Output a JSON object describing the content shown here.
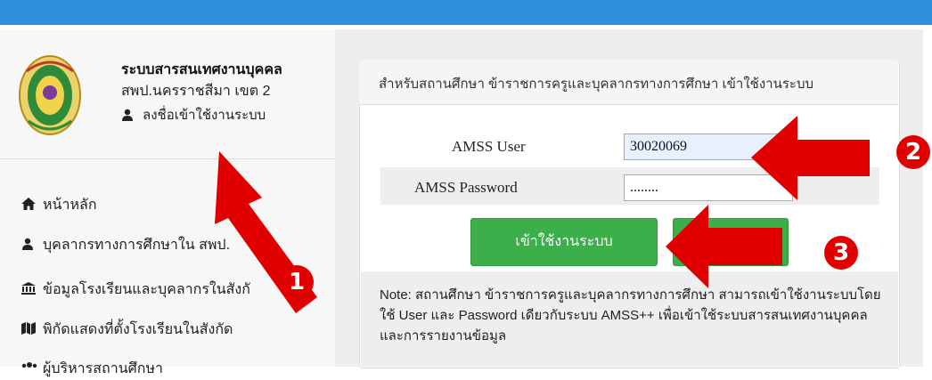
{
  "header": {
    "site_title": "ระบบสารสนเทศงานบุคคล",
    "site_subtitle": "สพป.นครราชสีมา เขต 2",
    "login_link": "ลงชื่อเข้าใช้งานระบบ"
  },
  "sidebar": {
    "items": [
      {
        "icon": "home-icon",
        "label": "หน้าหลัก"
      },
      {
        "icon": "user-icon",
        "label": "บุคลากรทางการศึกษาใน สพป."
      },
      {
        "icon": "bank-icon",
        "label": "ข้อมูลโรงเรียนและบุคลากรในสังกั"
      },
      {
        "icon": "map-icon",
        "label": "พิกัดแสดงที่ตั้งโรงเรียนในสังกัด"
      },
      {
        "icon": "users-icon",
        "label": "ผู้บริหารสถานศึกษา"
      }
    ]
  },
  "login_form": {
    "header": "สำหรับสถานศึกษา ข้าราชการครูและบุคลากรทางการศึกษา เข้าใช้งานระบบ",
    "user_label": "AMSS User",
    "user_value": "30020069",
    "password_label": "AMSS Password",
    "password_value": "........",
    "login_button": "เข้าใช้งานระบบ",
    "note": "Note: สถานศึกษา ข้าราชการครูและบุคลากรทางการศึกษา สามารถเข้าใช้งานระบบโดยใช้ User และ Password เดียวกับระบบ AMSS++ เพื่อเข้าใช้ระบบสารสนเทศงานบุคคล และการรายงานข้อมูล"
  },
  "annotations": {
    "step1": "1",
    "step2": "2",
    "step3": "3"
  },
  "colors": {
    "topbar": "#2f8fdb",
    "button": "#3cae4a",
    "arrow": "#e10000"
  }
}
